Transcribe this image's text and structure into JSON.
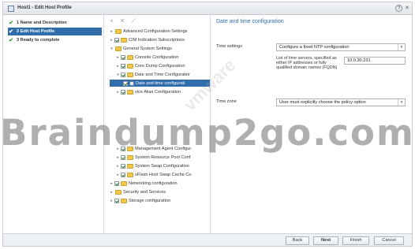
{
  "window": {
    "title": "Host1 - Edit Host Profile",
    "help_label": "?",
    "close_label": "✕"
  },
  "steps": [
    {
      "number": "1",
      "label": "1 Name and Description",
      "check": "✔"
    },
    {
      "number": "2",
      "label": "2 Edit Host Profile",
      "check": "✔"
    },
    {
      "number": "3",
      "label": "3 Ready to complete",
      "check": "✔"
    }
  ],
  "tree_toolbar": {
    "add": "+",
    "remove": "✕",
    "edit": "⟋"
  },
  "tree": [
    {
      "label": "Advanced Configuration Settings",
      "arrow": "▸"
    },
    {
      "label": "CIM Indication Subscriptions",
      "arrow": "▸"
    },
    {
      "label": "General System Settings",
      "arrow": "▾"
    },
    {
      "label": "Console Configuration",
      "arrow": "▸"
    },
    {
      "label": "Core Dump Configuration",
      "arrow": "▸"
    },
    {
      "label": "Date and Time Configuratior",
      "arrow": "▾"
    },
    {
      "label": "Date and time configurati",
      "arrow": ""
    },
    {
      "label": "vice Alias Configuration",
      "arrow": "▸"
    },
    {
      "label": "Management Agent Configur",
      "arrow": "▸"
    },
    {
      "label": "System Resource Pool Conf",
      "arrow": "▸"
    },
    {
      "label": "System Swap Configuration",
      "arrow": "▸"
    },
    {
      "label": "vFlash Host Swap Cache Co",
      "arrow": "▸"
    },
    {
      "label": "Networking configuration",
      "arrow": "▸"
    },
    {
      "label": "Security and Services",
      "arrow": "▸"
    },
    {
      "label": "Storage configuration",
      "arrow": "▸"
    }
  ],
  "detail": {
    "title": "Date and time configuration",
    "time_settings_label": "Time settings",
    "time_settings_value": "Configure a fixed NTP configuration",
    "ntp_servers_label": "List of time servers, specified as either IP addresses or fully qualified domain names (FQDN)",
    "ntp_servers_value": "10.0.30.231",
    "time_zone_label": "Time zone",
    "time_zone_value": "User must explicitly choose the policy option",
    "chevron": "▾"
  },
  "footer": {
    "back": "Back",
    "next": "Next",
    "finish": "Finish",
    "cancel": "Cancel"
  },
  "watermark": {
    "text": "Braindump2go.com",
    "vendor": "vmware"
  },
  "colors": {
    "accent": "#2f6eab",
    "check": "#3a9a2e",
    "folder": "#f2c94c"
  }
}
